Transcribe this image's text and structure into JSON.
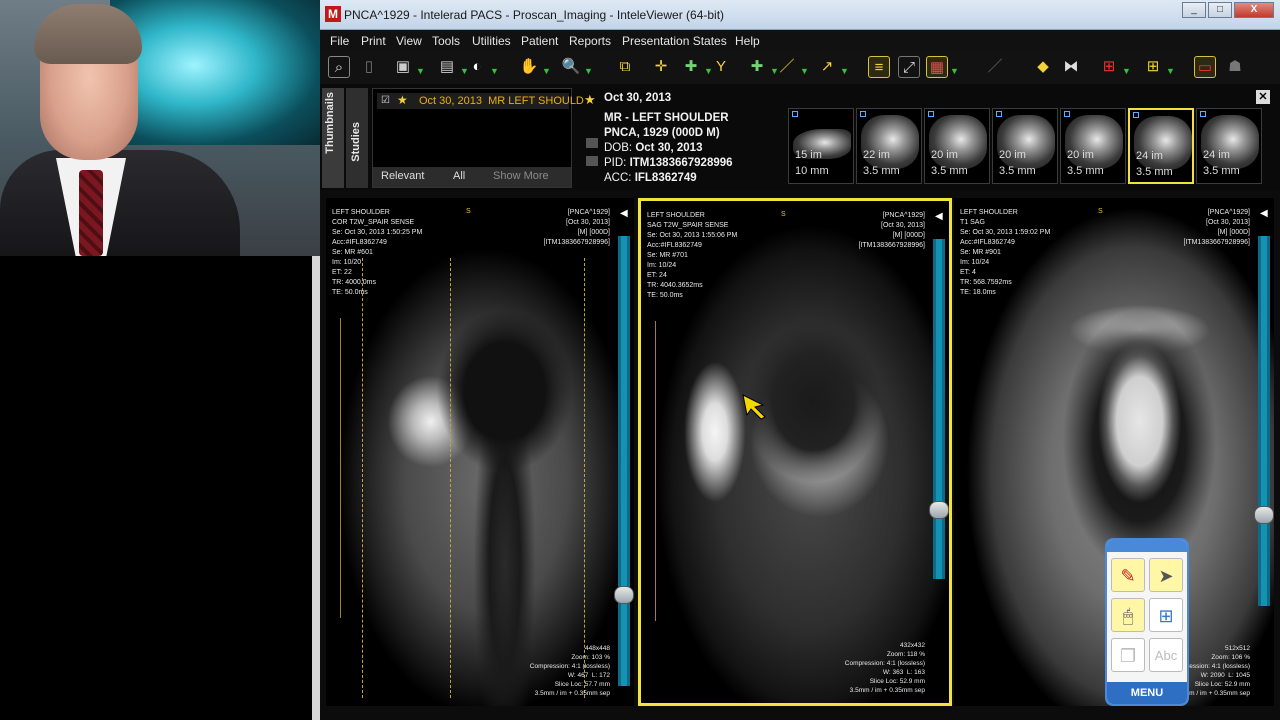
{
  "window": {
    "title": "PNCA^1929 - Intelerad PACS - Proscan_Imaging - InteleViewer (64-bit)",
    "logo_letter": "M",
    "controls": [
      "_",
      "□",
      "X"
    ]
  },
  "menu": [
    "File",
    "Print",
    "View",
    "Tools",
    "Utilities",
    "Patient",
    "Reports",
    "Presentation States",
    "Help"
  ],
  "sidebar_tabs": [
    "Thumbnails",
    "Studies"
  ],
  "study_list": {
    "row_date": "Oct 30, 2013",
    "row_text": "MR  LEFT SHOULD",
    "filters": [
      "Relevant",
      "All",
      "Show More"
    ]
  },
  "patient": {
    "date": "Oct 30, 2013",
    "study": "MR - LEFT SHOULDER",
    "name": "PNCA, 1929 (000D M)",
    "dob_label": "DOB:",
    "dob": "Oct 30, 2013",
    "pid_label": "PID:",
    "pid": "ITM1383667928996",
    "acc_label": "ACC:",
    "acc": "IFL8362749"
  },
  "thumbnails": [
    {
      "im": "15 im",
      "mm": "10 mm"
    },
    {
      "im": "22 im",
      "mm": "3.5 mm"
    },
    {
      "im": "20 im",
      "mm": "3.5 mm"
    },
    {
      "im": "20 im",
      "mm": "3.5 mm"
    },
    {
      "im": "20 im",
      "mm": "3.5 mm"
    },
    {
      "im": "24 im",
      "mm": "3.5 mm"
    },
    {
      "im": "24 im",
      "mm": "3.5 mm"
    }
  ],
  "viewports": [
    {
      "header_left": "LEFT SHOULDER\nCOR T2W_SPAIR SENSE\nSe: Oct 30, 2013 1:50:25 PM\nAcc:#IFL8362749\nSe: MR #601\nIm: 10/20\nET: 22\nTR: 4000.0ms\nTE: 50.0ms",
      "header_right": "[PNCA^1929]\n[Oct 30, 2013]\n[M] [000D]\n[ITM1383667928996]",
      "superior": "S",
      "footer": "448x448\nZoom: 103 %\nCompression: 4:1 (lossless)\nW: 467  L: 172\nSlice Loc: 57.7 mm\n3.5mm / im + 0.35mm sep"
    },
    {
      "header_left": "LEFT SHOULDER\nSAG T2W_SPAIR SENSE\nSe: Oct 30, 2013 1:55:06 PM\nAcc:#IFL8362749\nSe: MR #701\nIm: 10/24\nET: 24\nTR: 4040.3652ms\nTE: 50.0ms",
      "header_right": "[PNCA^1929]\n[Oct 30, 2013]\n[M] [000D]\n[ITM1383667928996]",
      "superior": "S",
      "footer": "432x432\nZoom: 118 %\nCompression: 4:1 (lossless)\nW: 363  L: 163\nSlice Loc: 52.9 mm\n3.5mm / im + 0.35mm sep"
    },
    {
      "header_left": "LEFT SHOULDER\nT1 SAG\nSe: Oct 30, 2013 1:59:02 PM\nAcc:#IFL8362749\nSe: MR #901\nIm: 10/24\nET: 4\nTR: 568.7592ms\nTE: 18.0ms",
      "header_right": "[PNCA^1929]\n[Oct 30, 2013]\n[M] [000D]\n[ITM1383667928996]",
      "superior": "S",
      "footer": "512x512\nZoom: 106 %\nCompression: 4:1 (lossless)\nW: 2090  L: 1045\nSlice Loc: 52.9 mm\n3.5mm / im + 0.35mm sep"
    }
  ],
  "palette": {
    "menu_label": "MENU",
    "text_tool": "Abc"
  },
  "colors": {
    "accent": "#f2e43a",
    "scrollbar": "#0e6a86"
  }
}
